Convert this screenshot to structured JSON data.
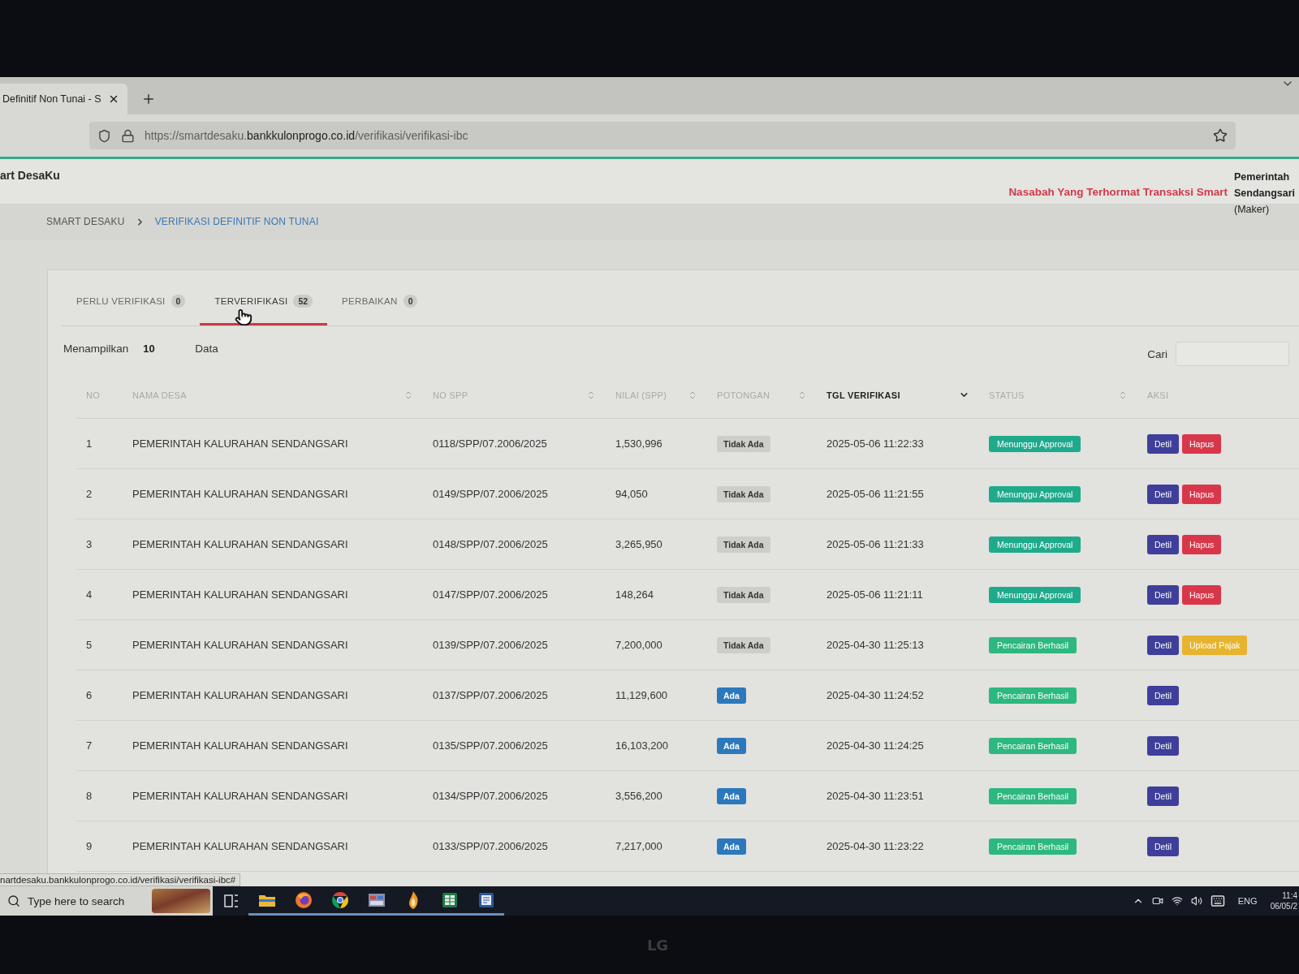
{
  "browser": {
    "tab_title": "Definitif Non Tunai - S",
    "url": "https://smartdesaku.**bankkulonprogo.co.id**/verifikasi/verifikasi-ibc"
  },
  "header": {
    "brand": "art DesaKu",
    "notice": "Nasabah Yang Terhormat Transaksi Smart",
    "user_lines": [
      "Pemerintah",
      "Sendangsari"
    ],
    "role": "(Maker)"
  },
  "breadcrumb": [
    {
      "label": "SMART DESAKU",
      "selected": false
    },
    {
      "label": "VERIFIKASI DEFINITIF NON TUNAI",
      "selected": true
    }
  ],
  "tabs": [
    {
      "label": "PERLU VERIFIKASI",
      "count": "0",
      "selected": false
    },
    {
      "label": "TERVERIFIKASI",
      "count": "52",
      "selected": true
    },
    {
      "label": "PERBAIKAN",
      "count": "0",
      "selected": false
    }
  ],
  "entries": {
    "label": "Menampilkan",
    "value": "10",
    "suffix": "Data"
  },
  "search": {
    "label": "Cari"
  },
  "table": {
    "columns": [
      {
        "label": "NO",
        "sortable": false,
        "sorted": false
      },
      {
        "label": "NAMA DESA",
        "sortable": true,
        "sorted": false
      },
      {
        "label": "NO SPP",
        "sortable": true,
        "sorted": false
      },
      {
        "label": "NILAI (SPP)",
        "sortable": true,
        "sorted": false
      },
      {
        "label": "POTONGAN",
        "sortable": true,
        "sorted": false
      },
      {
        "label": "TGL VERIFIKASI",
        "sortable": true,
        "sorted": true
      },
      {
        "label": "STATUS",
        "sortable": true,
        "sorted": false
      },
      {
        "label": "AKSI",
        "sortable": false,
        "sorted": false
      }
    ],
    "rows": [
      {
        "no": "1",
        "nama_desa": "PEMERINTAH KALURAHAN SENDANGSARI",
        "no_spp": "0118/SPP/07.2006/2025",
        "nilai": "1,530,996",
        "potongan": {
          "text": "Tidak Ada",
          "kind": "muted"
        },
        "tgl": "2025-05-06 11:22:33",
        "status": {
          "text": "Menunggu Approval",
          "color": "#1faa8c"
        },
        "actions": [
          {
            "label": "Detil",
            "kind": "detail"
          },
          {
            "label": "Hapus",
            "kind": "delete"
          }
        ]
      },
      {
        "no": "2",
        "nama_desa": "PEMERINTAH KALURAHAN SENDANGSARI",
        "no_spp": "0149/SPP/07.2006/2025",
        "nilai": "94,050",
        "potongan": {
          "text": "Tidak Ada",
          "kind": "muted"
        },
        "tgl": "2025-05-06 11:21:55",
        "status": {
          "text": "Menunggu Approval",
          "color": "#1faa8c"
        },
        "actions": [
          {
            "label": "Detil",
            "kind": "detail"
          },
          {
            "label": "Hapus",
            "kind": "delete"
          }
        ]
      },
      {
        "no": "3",
        "nama_desa": "PEMERINTAH KALURAHAN SENDANGSARI",
        "no_spp": "0148/SPP/07.2006/2025",
        "nilai": "3,265,950",
        "potongan": {
          "text": "Tidak Ada",
          "kind": "muted"
        },
        "tgl": "2025-05-06 11:21:33",
        "status": {
          "text": "Menunggu Approval",
          "color": "#1faa8c"
        },
        "actions": [
          {
            "label": "Detil",
            "kind": "detail"
          },
          {
            "label": "Hapus",
            "kind": "delete"
          }
        ]
      },
      {
        "no": "4",
        "nama_desa": "PEMERINTAH KALURAHAN SENDANGSARI",
        "no_spp": "0147/SPP/07.2006/2025",
        "nilai": "148,264",
        "potongan": {
          "text": "Tidak Ada",
          "kind": "muted"
        },
        "tgl": "2025-05-06 11:21:11",
        "status": {
          "text": "Menunggu Approval",
          "color": "#1faa8c"
        },
        "actions": [
          {
            "label": "Detil",
            "kind": "detail"
          },
          {
            "label": "Hapus",
            "kind": "delete"
          }
        ]
      },
      {
        "no": "5",
        "nama_desa": "PEMERINTAH KALURAHAN SENDANGSARI",
        "no_spp": "0139/SPP/07.2006/2025",
        "nilai": "7,200,000",
        "potongan": {
          "text": "Tidak Ada",
          "kind": "muted"
        },
        "tgl": "2025-04-30 11:25:13",
        "status": {
          "text": "Pencairan Berhasil",
          "color": "#2cb87e"
        },
        "actions": [
          {
            "label": "Detil",
            "kind": "detail"
          },
          {
            "label": "Upload Pajak",
            "kind": "upload"
          }
        ]
      },
      {
        "no": "6",
        "nama_desa": "PEMERINTAH KALURAHAN SENDANGSARI",
        "no_spp": "0137/SPP/07.2006/2025",
        "nilai": "11,129,600",
        "potongan": {
          "text": "Ada",
          "kind": "primary"
        },
        "tgl": "2025-04-30 11:24:52",
        "status": {
          "text": "Pencairan Berhasil",
          "color": "#2cb87e"
        },
        "actions": [
          {
            "label": "Detil",
            "kind": "detail"
          }
        ]
      },
      {
        "no": "7",
        "nama_desa": "PEMERINTAH KALURAHAN SENDANGSARI",
        "no_spp": "0135/SPP/07.2006/2025",
        "nilai": "16,103,200",
        "potongan": {
          "text": "Ada",
          "kind": "primary"
        },
        "tgl": "2025-04-30 11:24:25",
        "status": {
          "text": "Pencairan Berhasil",
          "color": "#2cb87e"
        },
        "actions": [
          {
            "label": "Detil",
            "kind": "detail"
          }
        ]
      },
      {
        "no": "8",
        "nama_desa": "PEMERINTAH KALURAHAN SENDANGSARI",
        "no_spp": "0134/SPP/07.2006/2025",
        "nilai": "3,556,200",
        "potongan": {
          "text": "Ada",
          "kind": "primary"
        },
        "tgl": "2025-04-30 11:23:51",
        "status": {
          "text": "Pencairan Berhasil",
          "color": "#2cb87e"
        },
        "actions": [
          {
            "label": "Detil",
            "kind": "detail"
          }
        ]
      },
      {
        "no": "9",
        "nama_desa": "PEMERINTAH KALURAHAN SENDANGSARI",
        "no_spp": "0133/SPP/07.2006/2025",
        "nilai": "7,217,000",
        "potongan": {
          "text": "Ada",
          "kind": "primary"
        },
        "tgl": "2025-04-30 11:23:22",
        "status": {
          "text": "Pencairan Berhasil",
          "color": "#2cb87e"
        },
        "actions": [
          {
            "label": "Detil",
            "kind": "detail"
          }
        ]
      }
    ]
  },
  "status_url": "nartdesaku.bankkulonprogo.co.id/verifikasi/verifikasi-ibc#",
  "taskbar": {
    "search_placeholder": "Type here to search",
    "apps": [
      {
        "kind": "folder",
        "running": true
      },
      {
        "kind": "fox",
        "running": true
      },
      {
        "kind": "ring",
        "running": true
      },
      {
        "kind": "window",
        "running": true
      },
      {
        "kind": "figure",
        "running": true
      },
      {
        "kind": "sheet",
        "running": true
      },
      {
        "kind": "doc",
        "running": true
      }
    ],
    "language": "ENG",
    "time": "11:4",
    "date": "06/05/2"
  },
  "bezel": {
    "logo": "LG"
  }
}
